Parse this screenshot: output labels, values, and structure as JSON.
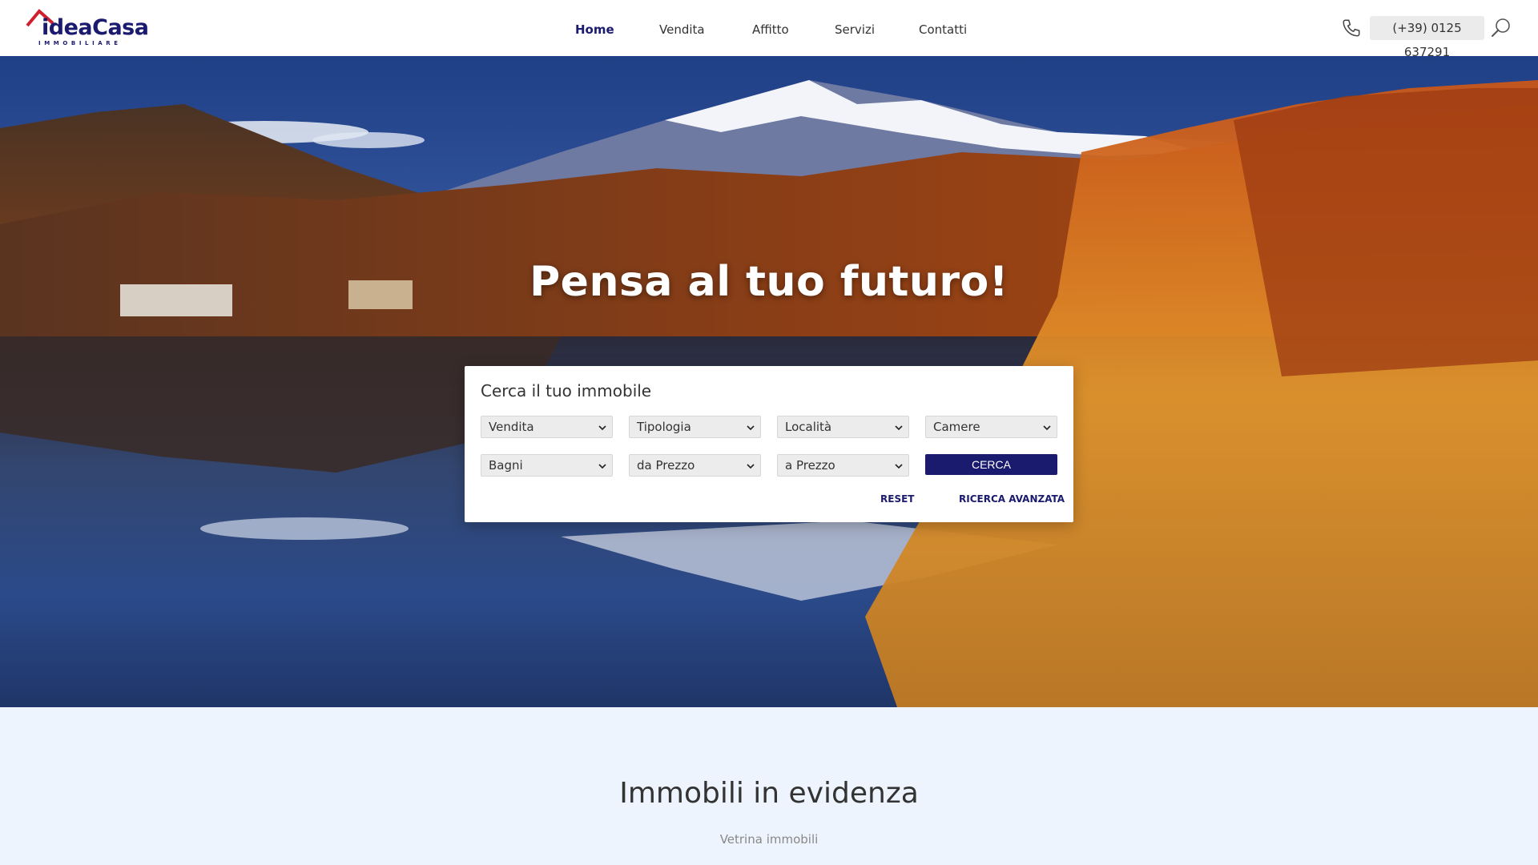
{
  "brand": {
    "name_part1": "idea",
    "name_part2": "Casa",
    "tagline": "IMMOBILIARE",
    "color_primary": "#1a1a6e",
    "color_accent": "#d0202e"
  },
  "nav": {
    "items": [
      {
        "label": "Home",
        "active": true
      },
      {
        "label": "Vendita",
        "active": false
      },
      {
        "label": "Affitto",
        "active": false
      },
      {
        "label": "Servizi",
        "active": false
      },
      {
        "label": "Contatti",
        "active": false
      }
    ]
  },
  "contact": {
    "phone": "(+39) 0125 637291",
    "phone_icon": "phone-icon",
    "search_icon": "search-icon"
  },
  "hero": {
    "title": "Pensa al tuo futuro!"
  },
  "search": {
    "title": "Cerca il tuo immobile",
    "fields": [
      "Vendita",
      "Tipologia",
      "Località",
      "Camere",
      "Bagni",
      "da Prezzo",
      "a Prezzo"
    ],
    "submit_label": "CERCA",
    "reset_label": "RESET",
    "advanced_label": "RICERCA AVANZATA"
  },
  "featured": {
    "title": "Immobili in evidenza",
    "subtitle": "Vetrina immobili"
  }
}
